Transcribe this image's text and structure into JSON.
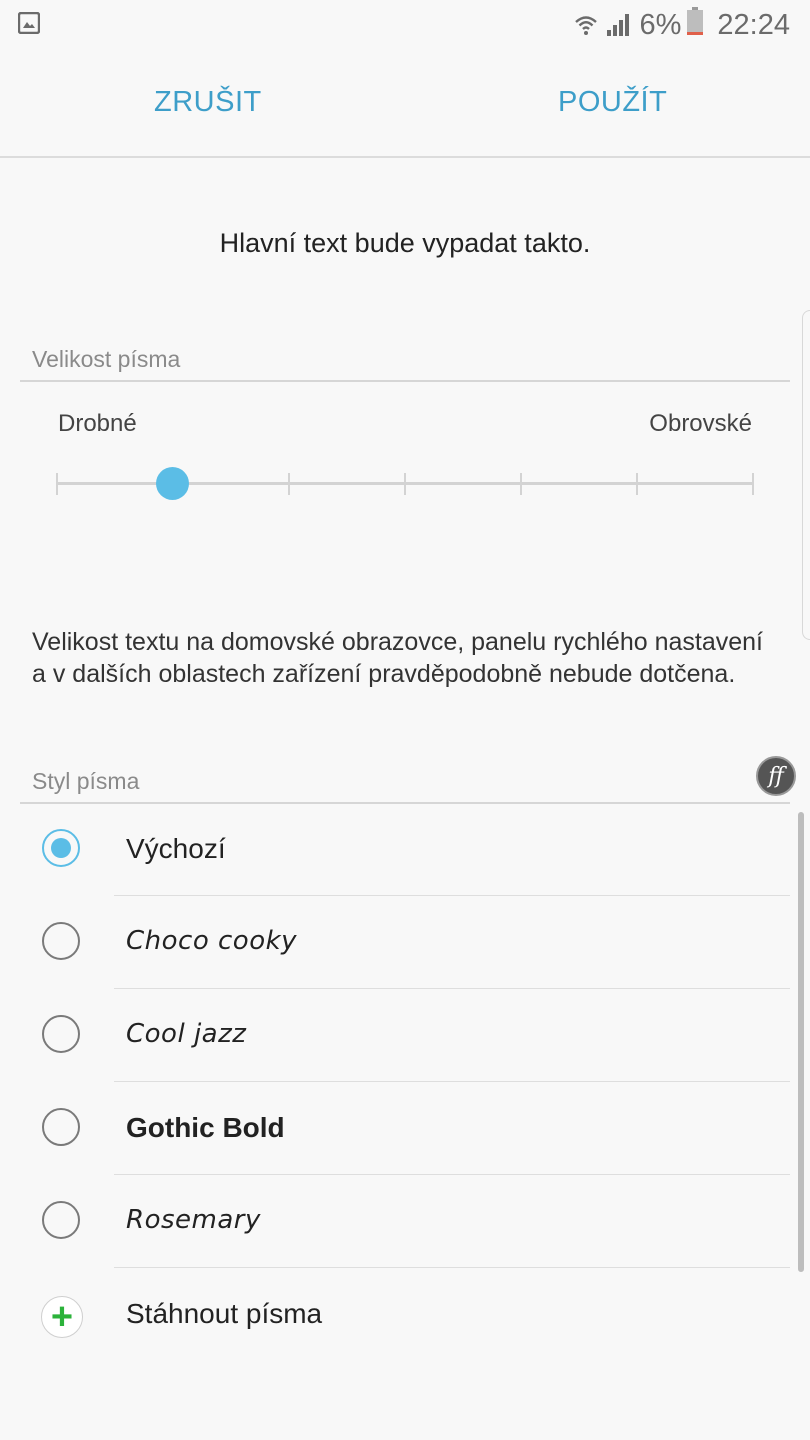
{
  "status_bar": {
    "battery_percent": "6%",
    "time": "22:24",
    "icons": [
      "gallery-icon",
      "wifi-icon",
      "signal-icon",
      "battery-icon"
    ]
  },
  "action_bar": {
    "cancel_label": "ZRUŠIT",
    "apply_label": "POUŽÍT"
  },
  "preview": {
    "text": "Hlavní text bude vypadat takto."
  },
  "font_size": {
    "header": "Velikost písma",
    "min_label": "Drobné",
    "max_label": "Obrovské",
    "steps": 7,
    "selected_index": 1
  },
  "info": {
    "text": "Velikost textu na domovské obrazovce, panelu rychlého nastavení a v dalších oblastech zařízení pravděpodobně nebude dotčena."
  },
  "font_style": {
    "header": "Styl písma",
    "icon": "ff-icon",
    "fonts": [
      {
        "label": "Výchozí",
        "selected": true
      },
      {
        "label": "Choco cooky",
        "selected": false
      },
      {
        "label": "Cool jazz",
        "selected": false
      },
      {
        "label": "Gothic Bold",
        "selected": false
      },
      {
        "label": "Rosemary",
        "selected": false
      }
    ],
    "download_label": "Stáhnout písma"
  },
  "colors": {
    "accent": "#5bbde6",
    "action_text": "#3d9ec9",
    "add_icon": "#2bb23a"
  }
}
